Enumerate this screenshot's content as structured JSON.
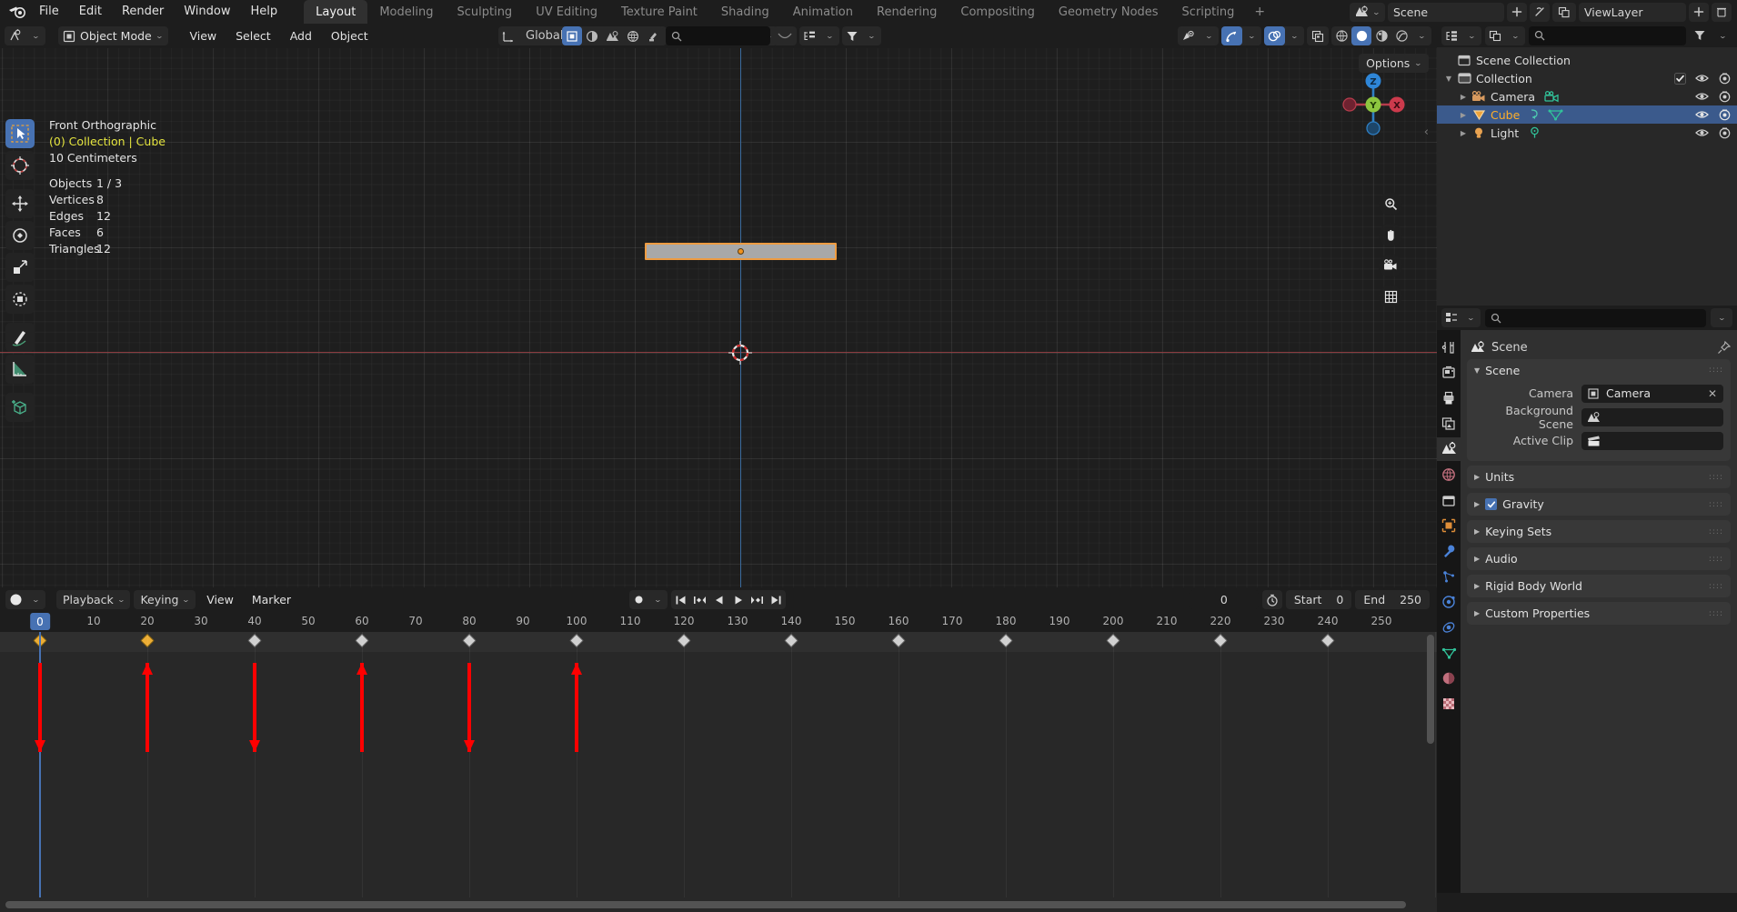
{
  "topbar": {
    "menus": [
      "File",
      "Edit",
      "Render",
      "Window",
      "Help"
    ],
    "workspaces": [
      "Layout",
      "Modeling",
      "Sculpting",
      "UV Editing",
      "Texture Paint",
      "Shading",
      "Animation",
      "Rendering",
      "Compositing",
      "Geometry Nodes",
      "Scripting"
    ],
    "active_workspace": "Layout",
    "add_tab": "+",
    "scene_name": "Scene",
    "view_layer_name": "ViewLayer"
  },
  "viewport_header": {
    "mode": "Object Mode",
    "menus": [
      "View",
      "Select",
      "Add",
      "Object"
    ],
    "transform_orientation": "Global",
    "options_label": "Options"
  },
  "viewport": {
    "view_name": "Front Orthographic",
    "collection_object": "(0) Collection | Cube",
    "grid_scale": "10 Centimeters",
    "stats": [
      {
        "key": "Objects",
        "value": "1 / 3"
      },
      {
        "key": "Vertices",
        "value": "8"
      },
      {
        "key": "Edges",
        "value": "12"
      },
      {
        "key": "Faces",
        "value": "6"
      },
      {
        "key": "Triangles",
        "value": "12"
      }
    ],
    "gizmo_axes": [
      "Z",
      "Y",
      "X"
    ],
    "object_color": "#ed9b41"
  },
  "outliner": {
    "root": "Scene Collection",
    "items": [
      {
        "label": "Collection",
        "indent": 0,
        "icon": "collection-icon",
        "selected": false,
        "has_checkbox": true
      },
      {
        "label": "Camera",
        "indent": 1,
        "icon": "camera-icon",
        "selected": false,
        "has_checkbox": false
      },
      {
        "label": "Cube",
        "indent": 1,
        "icon": "mesh-icon",
        "selected": true,
        "has_checkbox": false
      },
      {
        "label": "Light",
        "indent": 1,
        "icon": "light-icon",
        "selected": false,
        "has_checkbox": false
      }
    ]
  },
  "properties": {
    "breadcrumb": "Scene",
    "panels": [
      {
        "title": "Scene",
        "open": true,
        "checkbox": false
      },
      {
        "title": "Units",
        "open": false,
        "checkbox": false
      },
      {
        "title": "Gravity",
        "open": false,
        "checkbox": true,
        "checked": true
      },
      {
        "title": "Keying Sets",
        "open": false,
        "checkbox": false
      },
      {
        "title": "Audio",
        "open": false,
        "checkbox": false
      },
      {
        "title": "Rigid Body World",
        "open": false,
        "checkbox": false
      },
      {
        "title": "Custom Properties",
        "open": false,
        "checkbox": false
      }
    ],
    "scene_fields": [
      {
        "label": "Camera",
        "value": "Camera",
        "icon": "camera-data-icon",
        "clearable": true
      },
      {
        "label": "Background Scene",
        "value": "",
        "icon": "scene-icon",
        "clearable": false
      },
      {
        "label": "Active Clip",
        "value": "",
        "icon": "clip-icon",
        "clearable": false
      }
    ],
    "tabs": [
      "tool-icon",
      "render-icon",
      "output-icon",
      "view-layer-icon",
      "scene-icon",
      "world-icon",
      "collection-icon",
      "object-icon",
      "modifier-icon",
      "particles-icon",
      "physics-icon",
      "constraints-icon",
      "data-icon",
      "material-icon",
      "texture-icon"
    ],
    "active_tab_index": 4
  },
  "timeline": {
    "menus": [
      "Playback",
      "Keying",
      "View",
      "Marker"
    ],
    "current_frame": "0",
    "start_label": "Start",
    "start_value": "0",
    "end_label": "End",
    "end_value": "250",
    "tick_labels": [
      "0",
      "10",
      "20",
      "30",
      "40",
      "50",
      "60",
      "70",
      "80",
      "90",
      "100",
      "110",
      "120",
      "130",
      "140",
      "150",
      "160",
      "170",
      "180",
      "190",
      "200",
      "210",
      "220",
      "230",
      "240",
      "250"
    ],
    "playhead_frame": 0,
    "keyframes": [
      0,
      20,
      40,
      60,
      80,
      100,
      120,
      140,
      160,
      180,
      200,
      220,
      240
    ],
    "selected_keyframes": [
      0,
      20
    ],
    "annotations": [
      {
        "frame": 0,
        "direction": "down"
      },
      {
        "frame": 20,
        "direction": "up"
      },
      {
        "frame": 40,
        "direction": "down"
      },
      {
        "frame": 60,
        "direction": "up"
      },
      {
        "frame": 80,
        "direction": "down"
      },
      {
        "frame": 100,
        "direction": "up"
      }
    ],
    "annotation_color": "#ff0000"
  }
}
